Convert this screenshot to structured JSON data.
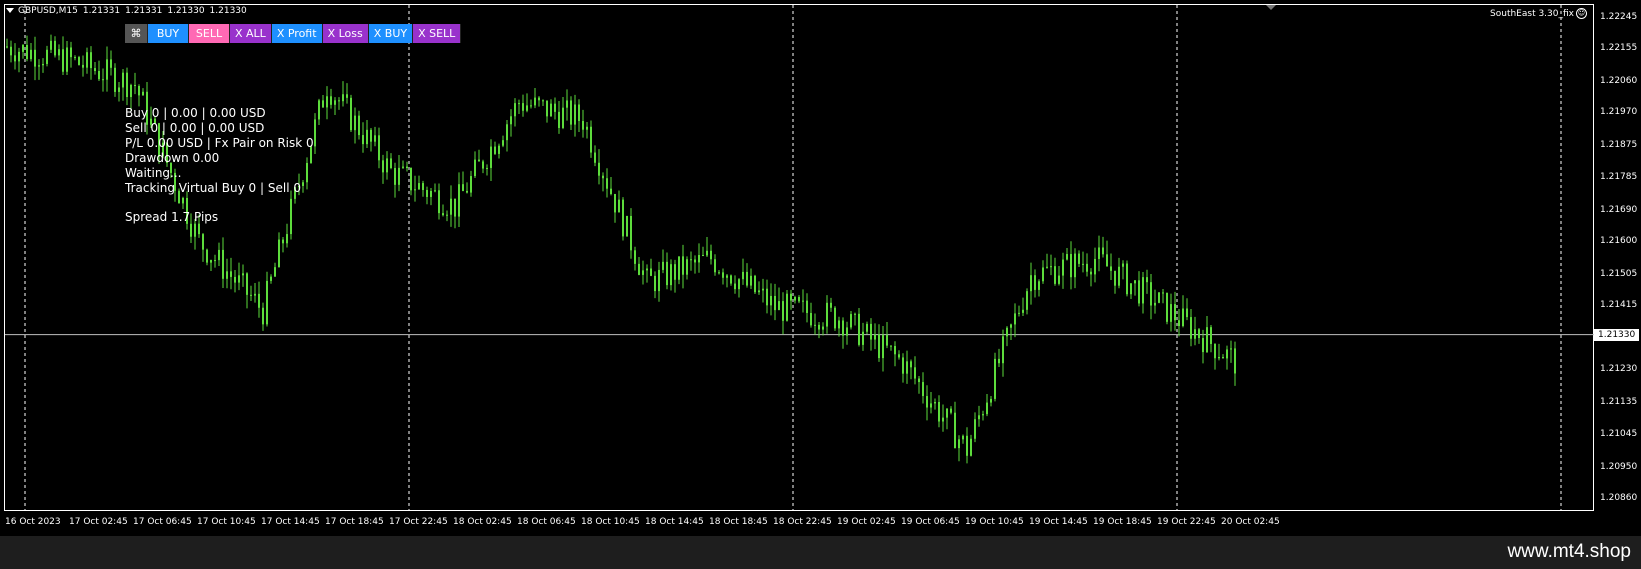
{
  "header": {
    "symbol": "GBPUSD,M15",
    "open": "1.21331",
    "high": "1.21331",
    "low": "1.21330",
    "close": "1.21330"
  },
  "ea_label": "SouthEast 3.30_fix",
  "toolbar": {
    "buy": "BUY",
    "sell": "SELL",
    "x_all": "X ALL",
    "x_profit": "X Profit",
    "x_loss": "X Loss",
    "x_buy": "X BUY",
    "x_sell": "X SELL"
  },
  "info": {
    "line1": "Buy 0 | 0.00 | 0.00 USD",
    "line2": "Sell 0 | 0.00 | 0.00 USD",
    "line3": "P/L 0.00 USD | Fx Pair on Risk 0",
    "line4": "Drawdown 0.00",
    "line5": "Waiting...",
    "line6": "Tracking Virtual Buy 0 | Sell 0",
    "line7": "Spread 1.7 Pips"
  },
  "price_axis": {
    "labels": [
      "1.22245",
      "1.22155",
      "1.22060",
      "1.21970",
      "1.21875",
      "1.21785",
      "1.21690",
      "1.21600",
      "1.21505",
      "1.21415",
      "1.21330",
      "1.21230",
      "1.21135",
      "1.21045",
      "1.20950",
      "1.20860"
    ],
    "current": "1.21330"
  },
  "time_axis": [
    "16 Oct 2023",
    "17 Oct 02:45",
    "17 Oct 06:45",
    "17 Oct 10:45",
    "17 Oct 14:45",
    "17 Oct 18:45",
    "17 Oct 22:45",
    "18 Oct 02:45",
    "18 Oct 06:45",
    "18 Oct 10:45",
    "18 Oct 14:45",
    "18 Oct 18:45",
    "18 Oct 22:45",
    "19 Oct 02:45",
    "19 Oct 06:45",
    "19 Oct 10:45",
    "19 Oct 14:45",
    "19 Oct 18:45",
    "19 Oct 22:45",
    "20 Oct 02:45"
  ],
  "colors": {
    "background": "#000000",
    "candle": "#5ddc3c",
    "grid": "#ffffff",
    "frame": "#ffffff",
    "price_line": "#c0c0c0"
  },
  "watermark": "www.mt4.shop",
  "chart_data": {
    "type": "line",
    "title": "",
    "ylim": [
      1.20825,
      1.22265
    ],
    "x": [
      "16 Oct 2023",
      "17 Oct 02:45",
      "17 Oct 06:45",
      "17 Oct 10:45",
      "17 Oct 14:45",
      "17 Oct 18:45",
      "17 Oct 22:45",
      "18 Oct 02:45",
      "18 Oct 06:45",
      "18 Oct 10:45",
      "18 Oct 14:45",
      "18 Oct 18:45",
      "18 Oct 22:45",
      "19 Oct 02:45",
      "19 Oct 06:45",
      "19 Oct 10:45",
      "19 Oct 14:45",
      "19 Oct 18:45",
      "19 Oct 22:45",
      "20 Oct 02:45"
    ],
    "series": [
      {
        "values": [
          1.2216,
          1.2212,
          1.2205,
          1.216,
          1.214,
          1.2205,
          1.218,
          1.217,
          1.22,
          1.2195,
          1.2148,
          1.2155,
          1.2141,
          1.2138,
          1.2125,
          1.21,
          1.215,
          1.2155,
          1.2142,
          1.2128
        ]
      }
    ]
  }
}
